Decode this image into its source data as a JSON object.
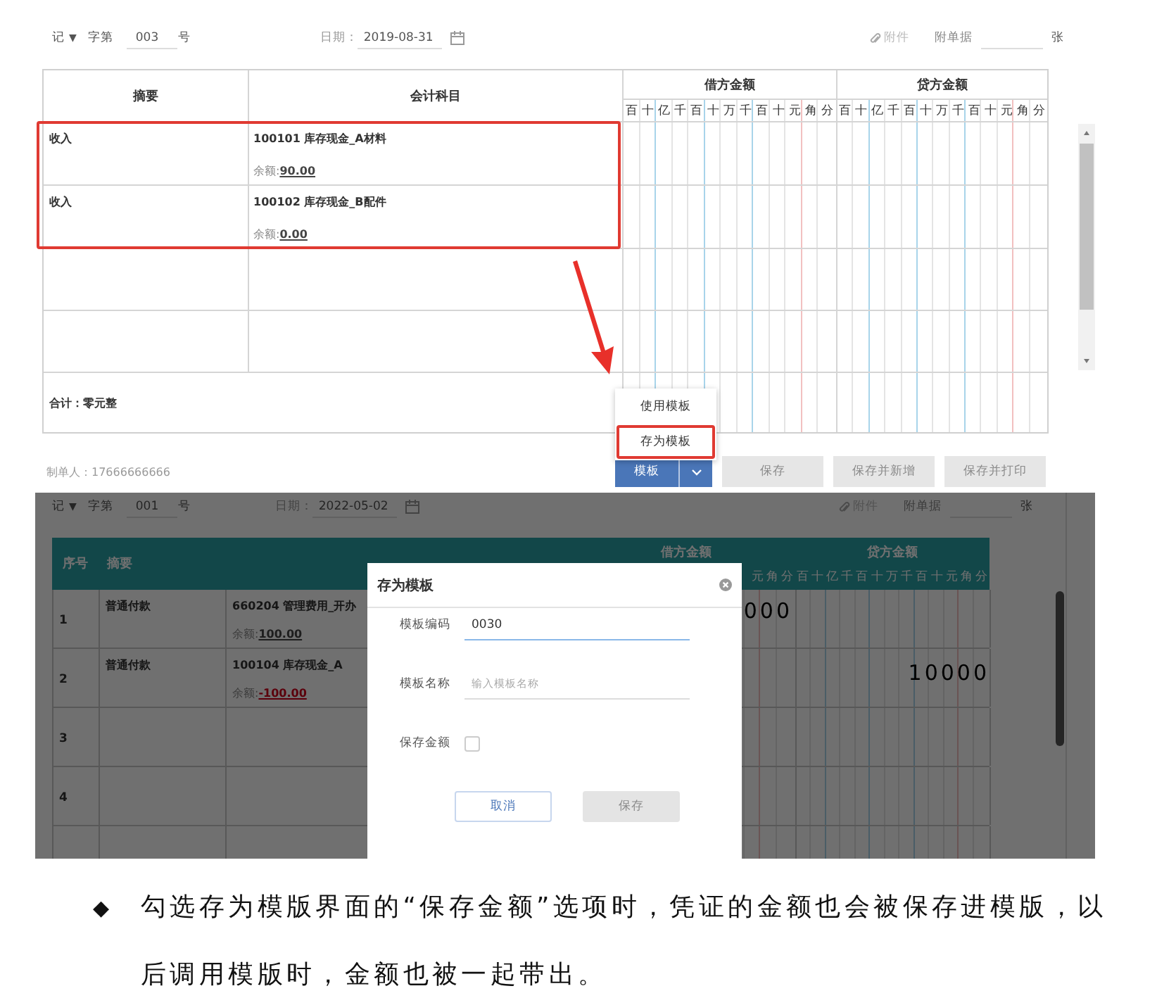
{
  "top_voucher": {
    "header": {
      "type": "记",
      "type_caret": "▼",
      "prefix": "字第",
      "number": "003",
      "suffix": "号",
      "date_label": "日期：",
      "date": "2019-08-31",
      "attachment": "附件",
      "bills_label": "附单据",
      "bills_unit": "张"
    },
    "columns": {
      "summary": "摘要",
      "account": "会计科目",
      "debit": "借方金额",
      "credit": "贷方金额",
      "debit_digits": [
        "百",
        "十",
        "亿",
        "千",
        "百",
        "十",
        "万",
        "千",
        "百",
        "十",
        "元",
        "角",
        "分"
      ],
      "credit_digits": [
        "百",
        "十",
        "亿",
        "千",
        "百",
        "十",
        "万",
        "千",
        "百",
        "十",
        "元",
        "角",
        "分"
      ]
    },
    "rows": [
      {
        "kind": "entry",
        "summary": "收入",
        "account": "100101 库存现金_A材料",
        "balance_label": "余额:",
        "balance": "90.00",
        "highlighted": true
      },
      {
        "kind": "entry",
        "summary": "收入",
        "account": "100102 库存现金_B配件",
        "balance_label": "余额:",
        "balance": "0.00",
        "highlighted": true
      },
      {
        "kind": "blank",
        "highlighted": false
      },
      {
        "kind": "blank",
        "highlighted": false
      }
    ],
    "total": "合计：零元整",
    "maker": "制单人：17666666666",
    "menu": [
      {
        "label": "使用模板",
        "selected": false
      },
      {
        "label": "存为模板",
        "selected": true
      }
    ],
    "buttons": [
      {
        "label": "模板",
        "kind": "split",
        "disabled": false
      },
      {
        "label": "保存",
        "kind": "plain",
        "disabled": true
      },
      {
        "label": "保存并新增",
        "kind": "plain",
        "disabled": true
      },
      {
        "label": "保存并打印",
        "kind": "plain",
        "disabled": true
      }
    ]
  },
  "bottom_voucher": {
    "header": {
      "type": "记",
      "type_caret": "▼",
      "prefix": "字第",
      "number": "001",
      "suffix": "号",
      "date_label": "日期：",
      "date": "2022-05-02",
      "attachment": "附件",
      "bills_label": "附单据",
      "bills_unit": "张"
    },
    "columns": {
      "index": "序号",
      "summary": "摘要",
      "debit": "借方金额",
      "credit": "贷方金额",
      "debit_digits": [
        "元",
        "角",
        "分"
      ],
      "credit_digits": [
        "百",
        "十",
        "亿",
        "千",
        "百",
        "十",
        "万",
        "千",
        "百",
        "十",
        "元",
        "角",
        "分"
      ]
    },
    "rows": [
      {
        "index": "1",
        "summary": "普通付款",
        "account": "660204 管理费用_开办",
        "balance_label": "余额:",
        "balance": "100.00",
        "negative": false,
        "debit": "000"
      },
      {
        "index": "2",
        "summary": "普通付款",
        "account": "100104 库存现金_A",
        "balance_label": "余额:",
        "balance": "-100.00",
        "negative": true,
        "credit": "10000"
      },
      {
        "index": "3"
      },
      {
        "index": "4"
      },
      {}
    ],
    "dialog": {
      "title": "存为模板",
      "fields": [
        {
          "kind": "text",
          "label": "模板编码",
          "value": "0030",
          "focused": true
        },
        {
          "kind": "text",
          "label": "模板名称",
          "placeholder": "输入模板名称",
          "focused": false
        },
        {
          "kind": "checkbox",
          "label": "保存金额",
          "checked": false
        }
      ],
      "buttons": [
        {
          "label": "取消",
          "kind": "secondary",
          "disabled": false
        },
        {
          "label": "保存",
          "kind": "primary",
          "disabled": true
        }
      ]
    }
  },
  "note": {
    "bullet": "◆",
    "text": "勾选存为模版界面的“保存金额”选项时，凭证的金额也会被保存进模版，以后调用模版时，金额也被一起带出。"
  }
}
